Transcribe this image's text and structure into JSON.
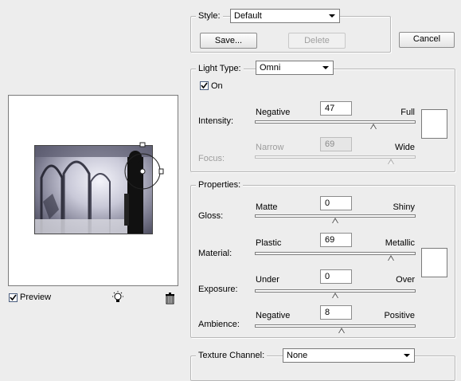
{
  "style_group": {
    "label": "Style:",
    "selected": "Default",
    "save_label": "Save...",
    "delete_label": "Delete",
    "cancel_label": "Cancel"
  },
  "light_type_group": {
    "label": "Light Type:",
    "selected": "Omni",
    "on_label": "On",
    "on_checked": true,
    "intensity": {
      "label": "Intensity:",
      "left": "Negative",
      "right": "Full",
      "value": "47",
      "fraction": 0.74
    },
    "focus": {
      "label": "Focus:",
      "left": "Narrow",
      "right": "Wide",
      "value": "69",
      "fraction": 0.85
    },
    "light_color": "#ffffff"
  },
  "properties_group": {
    "label": "Properties:",
    "gloss": {
      "label": "Gloss:",
      "left": "Matte",
      "right": "Shiny",
      "value": "0",
      "fraction": 0.5
    },
    "material": {
      "label": "Material:",
      "left": "Plastic",
      "right": "Metallic",
      "value": "69",
      "fraction": 0.85
    },
    "exposure": {
      "label": "Exposure:",
      "left": "Under",
      "right": "Over",
      "value": "0",
      "fraction": 0.5
    },
    "ambience": {
      "label": "Ambience:",
      "left": "Negative",
      "right": "Positive",
      "value": "8",
      "fraction": 0.54
    },
    "ambient_color": "#ffffff"
  },
  "texture_group": {
    "label": "Texture Channel:",
    "selected": "None"
  },
  "preview": {
    "label": "Preview",
    "checked": true,
    "new_light_icon": "lightbulb-icon",
    "delete_light_icon": "trash-icon"
  }
}
